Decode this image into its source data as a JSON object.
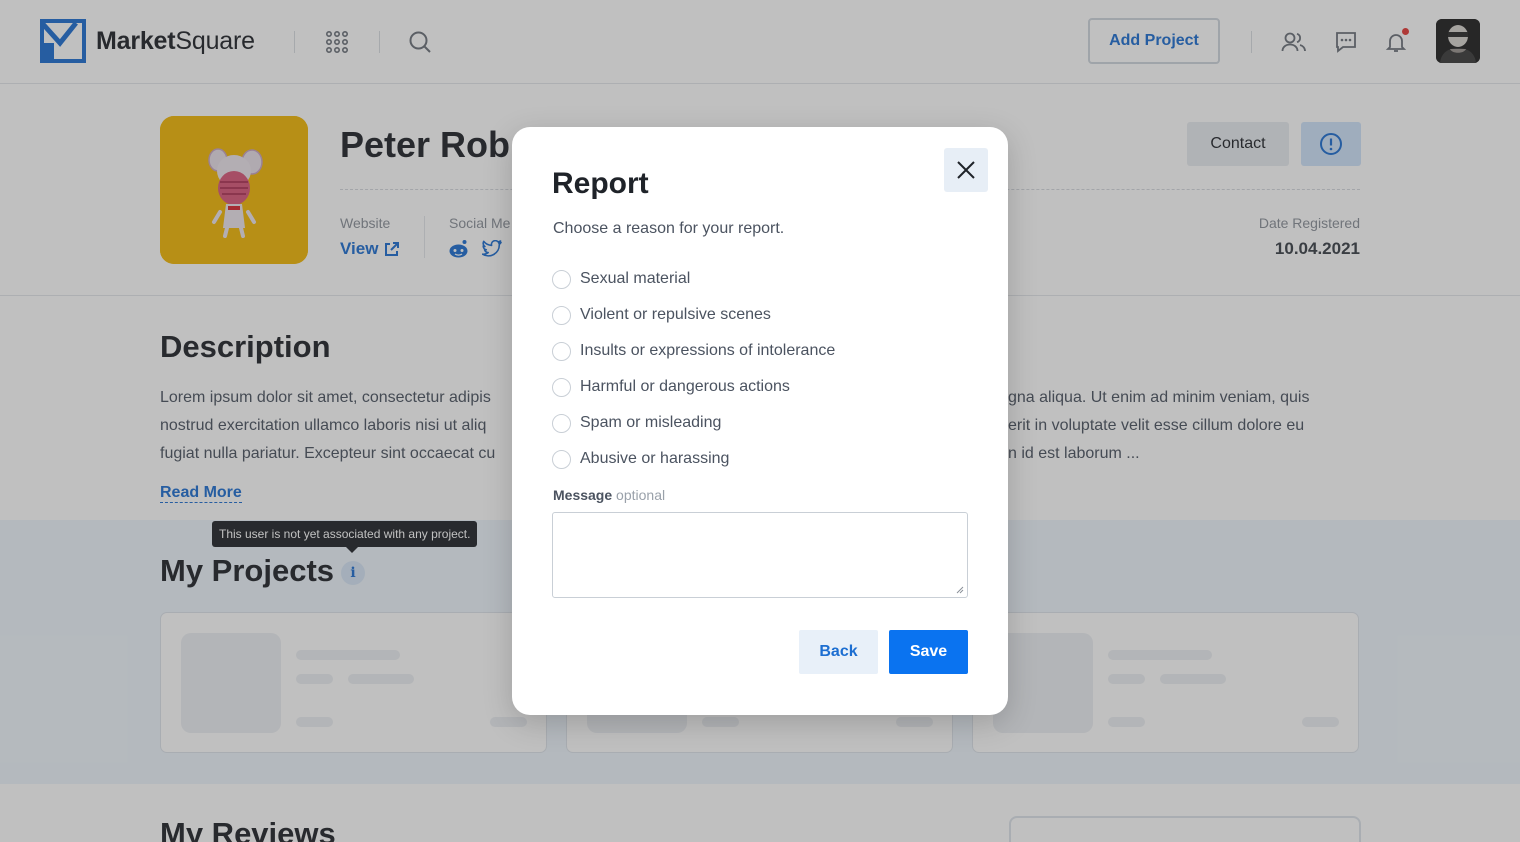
{
  "header": {
    "brand_bold": "Market",
    "brand_light": "Square",
    "add_project_label": "Add Project",
    "icons": [
      "apps-grid-icon",
      "search-icon",
      "users-icon",
      "chat-icon",
      "bell-icon"
    ],
    "has_notification": true
  },
  "profile": {
    "name": "Peter Rob",
    "website_label": "Website",
    "website_link": "View",
    "social_label": "Social Me",
    "social_icons": [
      "reddit-icon",
      "twitter-icon"
    ],
    "date_label": "Date Registered",
    "date_value": "10.04.2021",
    "contact_label": "Contact"
  },
  "description": {
    "title": "Description",
    "left_lines": [
      "Lorem ipsum dolor sit amet, consectetur adipis",
      "nostrud exercitation ullamco laboris nisi ut aliq",
      "fugiat nulla pariatur. Excepteur sint occaecat cu"
    ],
    "right_lines": [
      "gna aliqua. Ut enim ad minim veniam, quis",
      "erit in voluptate velit esse cillum dolore eu",
      "n id est laborum ..."
    ],
    "read_more": "Read More"
  },
  "projects": {
    "title": "My Projects",
    "info_glyph": "i",
    "tooltip": "This user is not yet associated with any project."
  },
  "reviews": {
    "title": "My Reviews"
  },
  "modal": {
    "title": "Report",
    "subtitle": "Choose a reason for your report.",
    "reasons": [
      {
        "label": "Sexual material"
      },
      {
        "label": "Violent or repulsive scenes"
      },
      {
        "label": "Insults or expressions of intolerance"
      },
      {
        "label": "Harmful or dangerous actions"
      },
      {
        "label": "Spam or misleading"
      },
      {
        "label": "Abusive or harassing"
      }
    ],
    "message_label": "Message",
    "message_optional": "optional",
    "message_value": "",
    "back_label": "Back",
    "save_label": "Save"
  },
  "colors": {
    "accent": "#1c6ed1",
    "primary_button": "#0a73f0",
    "profile_pic_bg": "#f2b705",
    "notification": "#e53935",
    "overlay": "rgba(60,60,60,0.32)"
  }
}
